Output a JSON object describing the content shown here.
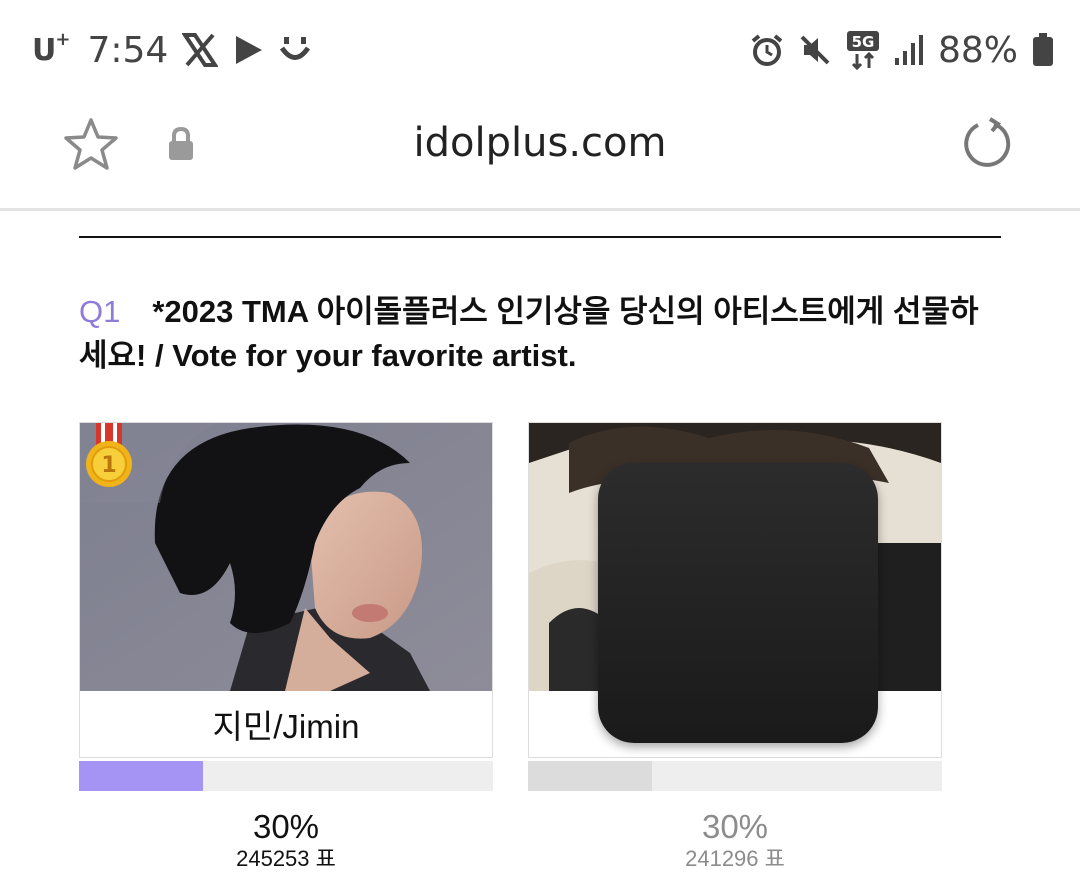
{
  "status_bar": {
    "carrier": "U",
    "carrier_plus": "+",
    "time": "7:54",
    "network": "5G",
    "battery": "88%"
  },
  "browser": {
    "domain": "idolplus.com"
  },
  "question": {
    "number": "Q1",
    "text": "*2023 TMA 아이돌플러스 인기상을 당신의 아티스트에게 선물하세요! / Vote for your favorite artist."
  },
  "candidates": [
    {
      "name": "지민/Jimin",
      "percent": "30%",
      "votes": "245253 표",
      "bar_fill": 0.3,
      "rank": "1",
      "bar_color": "#a694f5"
    },
    {
      "name": "",
      "percent": "30%",
      "votes": "241296 표",
      "bar_fill": 0.3,
      "bar_color": "#dcdcdc"
    }
  ]
}
